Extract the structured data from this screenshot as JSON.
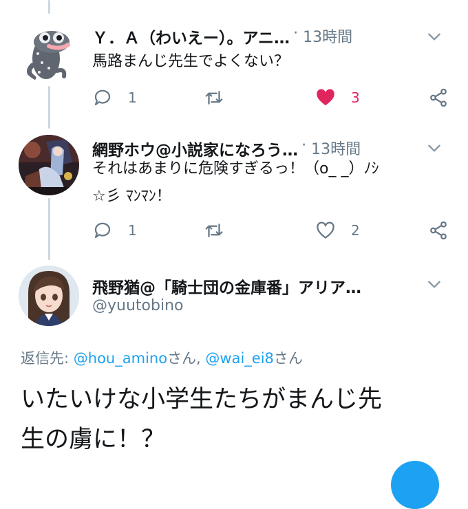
{
  "colors": {
    "accent": "#1da1f2",
    "like": "#e0245e",
    "muted": "#657786",
    "text": "#14171a",
    "thread": "#ccd6dd"
  },
  "tweets": [
    {
      "name": "Ｙ．Ａ（わいえー）。アニ…",
      "time": "13時間",
      "text": "馬路まんじ先生でよくない？",
      "replies": "1",
      "retweets": "",
      "likes": "3",
      "liked": true,
      "avatar_icon": "gray-creature-avatar"
    },
    {
      "name": "網野ホウ@小説家になろう…",
      "time": "13時間",
      "text_line1": "それはあまりに危険すぎるっ！（o_ _）ﾉｼ",
      "text_line2": "☆彡 ﾏﾝﾏﾝ！",
      "replies": "1",
      "retweets": "",
      "likes": "2",
      "liked": false,
      "avatar_icon": "illustration-avatar"
    }
  ],
  "focused": {
    "name": "飛野猶@「騎士団の金庫番」アリア…",
    "handle": "@yuutobino",
    "reply_prefix": "返信先: ",
    "mention1": "@hou_amino",
    "san1": "さん, ",
    "mention2": "@wai_ei8",
    "san2": "さん",
    "text_line1": "いたいけな小学生たちがまんじ先",
    "text_line2": "生の虜に！？",
    "avatar_icon": "anime-girl-avatar"
  }
}
